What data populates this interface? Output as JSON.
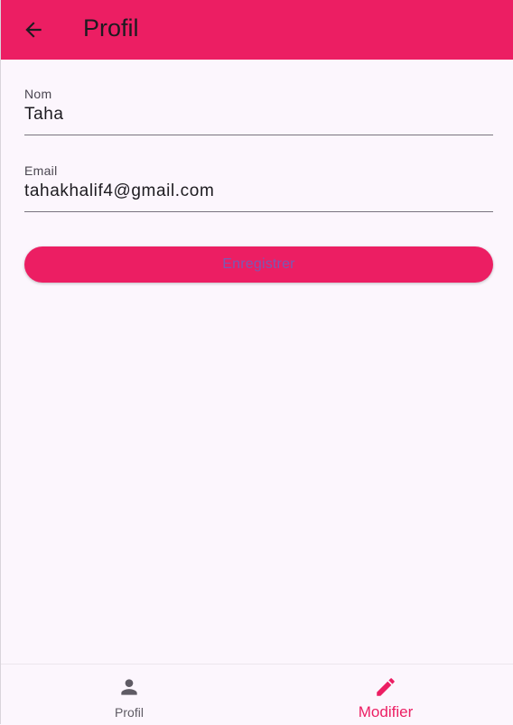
{
  "appbar": {
    "title": "Profil",
    "back_icon": "arrow-back-icon",
    "background_color": "#EC1E63"
  },
  "form": {
    "name_field": {
      "label": "Nom",
      "value": "Taha"
    },
    "email_field": {
      "label": "Email",
      "value": "tahakhalif4@gmail.com"
    },
    "save_button": {
      "label": "Enregistrer"
    }
  },
  "bottom_nav": {
    "items": [
      {
        "label": "Profil",
        "icon": "person-icon",
        "active": false
      },
      {
        "label": "Modifier",
        "icon": "edit-pencil-icon",
        "active": true
      }
    ],
    "active_color": "#EC1E63",
    "inactive_color": "#5f5b64"
  }
}
